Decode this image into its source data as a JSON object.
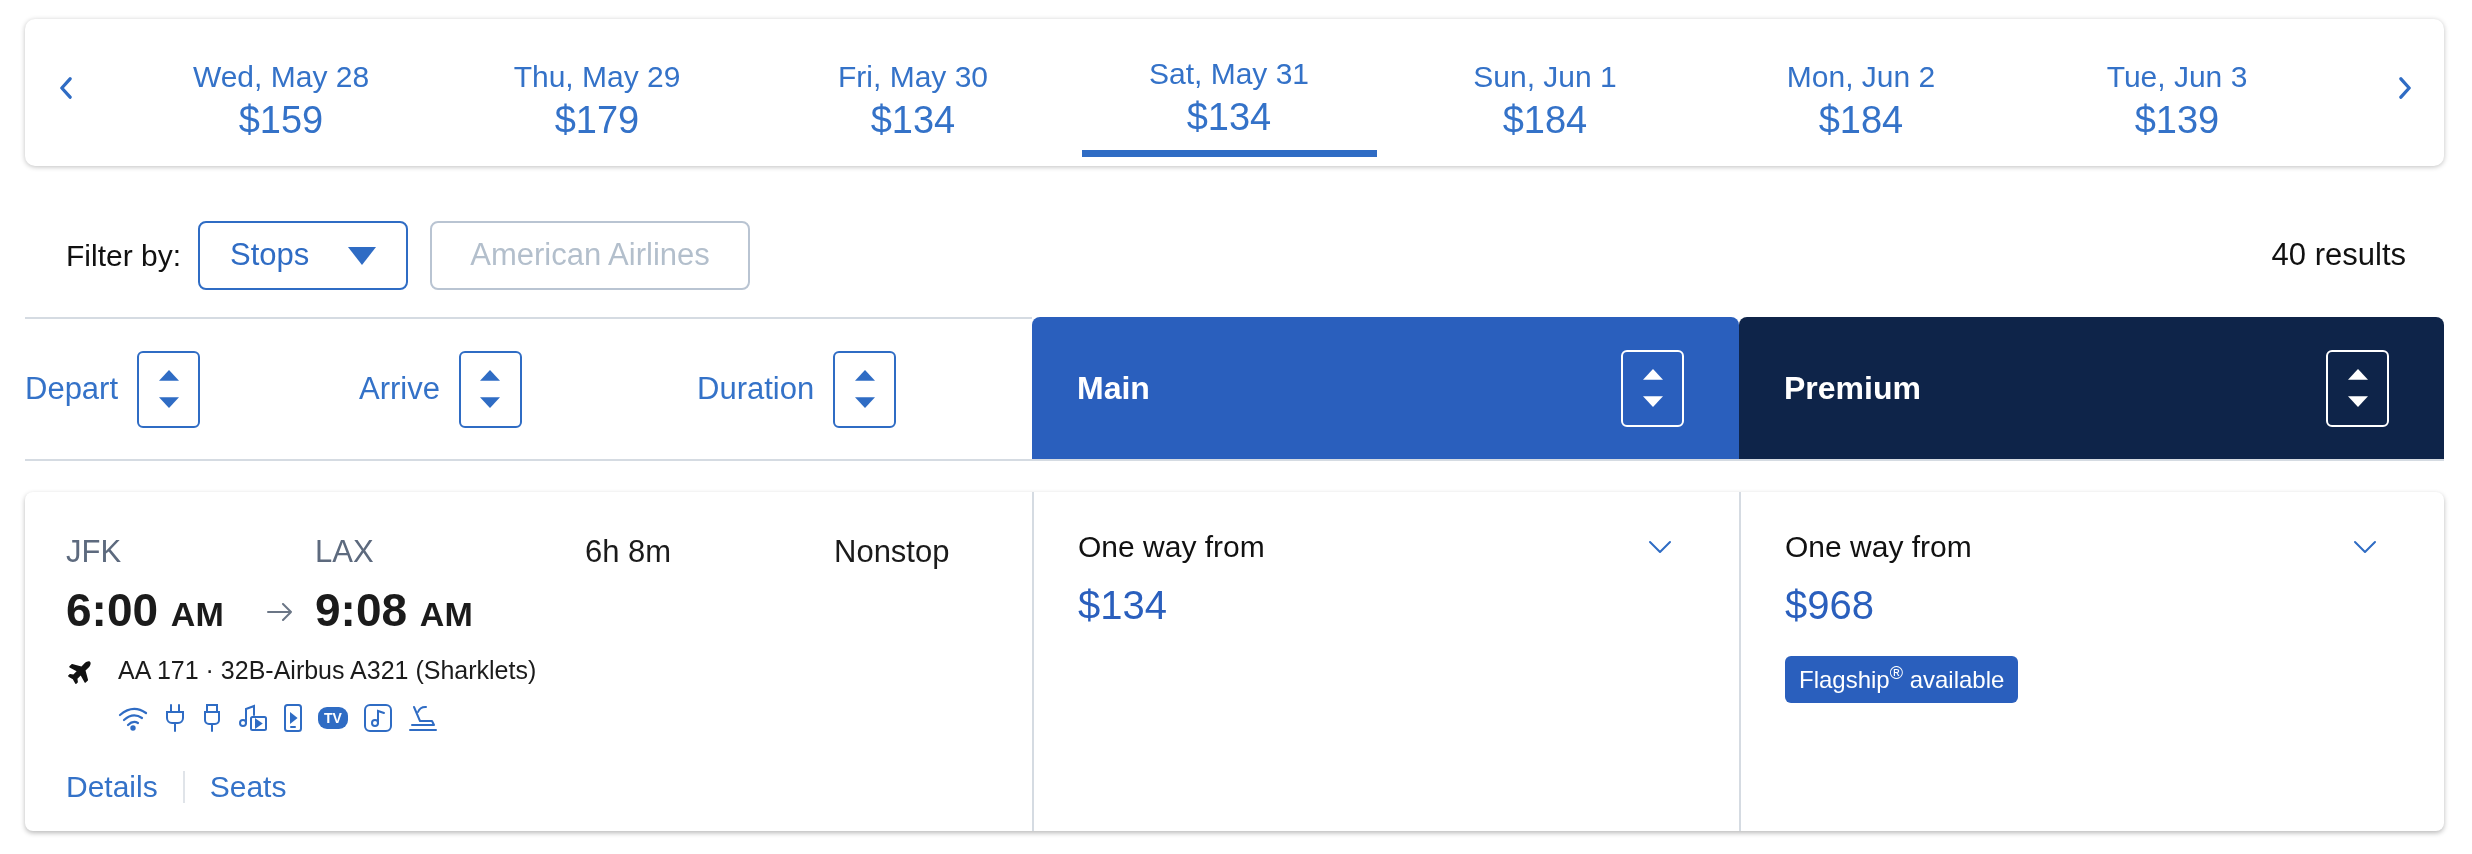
{
  "date_bar": {
    "items": [
      {
        "date": "Wed, May 28",
        "price": "$159",
        "selected": false
      },
      {
        "date": "Thu, May 29",
        "price": "$179",
        "selected": false
      },
      {
        "date": "Fri, May 30",
        "price": "$134",
        "selected": false
      },
      {
        "date": "Sat, May 31",
        "price": "$134",
        "selected": true
      },
      {
        "date": "Sun, Jun 1",
        "price": "$184",
        "selected": false
      },
      {
        "date": "Mon, Jun 2",
        "price": "$184",
        "selected": false
      },
      {
        "date": "Tue, Jun 3",
        "price": "$139",
        "selected": false
      }
    ]
  },
  "filter": {
    "label": "Filter by:",
    "buttons": [
      {
        "label": "Stops",
        "kind": "dropdown",
        "disabled": false
      },
      {
        "label": "American Airlines",
        "kind": "toggle",
        "disabled": true
      }
    ]
  },
  "results_count": "40 results",
  "sort_columns": [
    {
      "label": "Depart"
    },
    {
      "label": "Arrive"
    },
    {
      "label": "Duration"
    }
  ],
  "cabins": [
    {
      "label": "Main",
      "color": "#2a5fbd"
    },
    {
      "label": "Premium",
      "color": "#0e2449"
    }
  ],
  "flight": {
    "origin": "JFK",
    "destination": "LAX",
    "departure_time": "6:00",
    "departure_period": "AM",
    "arrival_time": "9:08",
    "arrival_period": "AM",
    "duration": "6h 8m",
    "stops": "Nonstop",
    "details": "AA 171 · 32B-Airbus A321 (Sharklets)",
    "amenities": [
      {
        "kind": "wifi"
      },
      {
        "kind": "power"
      },
      {
        "kind": "usb"
      },
      {
        "kind": "entertainment"
      },
      {
        "kind": "mobile"
      },
      {
        "kind": "tv",
        "label": "TV"
      },
      {
        "kind": "audio"
      },
      {
        "kind": "seat"
      }
    ],
    "links": [
      "Details",
      "Seats"
    ]
  },
  "fares": [
    {
      "label": "One way from",
      "price": "$134"
    },
    {
      "label": "One way from",
      "price": "$968",
      "badge": "Flagship$^{®}$ available"
    }
  ]
}
